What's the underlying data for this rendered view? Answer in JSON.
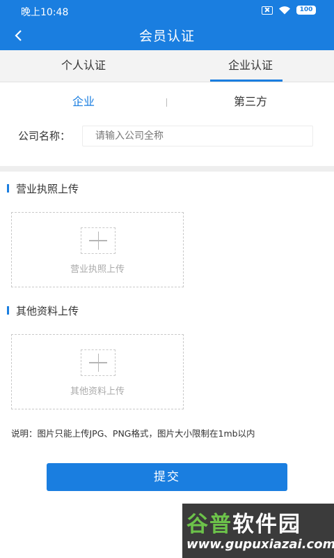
{
  "status_bar": {
    "time": "晚上10:48",
    "battery": "100",
    "icons": [
      "sim-off-icon",
      "wifi-icon",
      "battery-icon"
    ]
  },
  "nav": {
    "back_icon": "‹",
    "title": "会员认证"
  },
  "tabs": {
    "items": [
      {
        "label": "个人认证",
        "active": false
      },
      {
        "label": "企业认证",
        "active": true
      }
    ]
  },
  "subtabs": {
    "items": [
      {
        "label": "企业",
        "active": true
      },
      {
        "label": "第三方",
        "active": false
      }
    ]
  },
  "form": {
    "company_label": "公司名称：",
    "company_placeholder": "请输入公司全称",
    "company_value": ""
  },
  "sections": {
    "license": {
      "title": "营业执照上传",
      "upload_label": "营业执照上传"
    },
    "other": {
      "title": "其他资料上传",
      "upload_label": "其他资料上传"
    }
  },
  "note": "说明：图片只能上传JPG、PNG格式，图片大小限制在1mb以内",
  "submit_label": "提交",
  "watermark": {
    "brand_part1": "谷普",
    "brand_part2": "软件园",
    "url": "www.gupuxiazai.com"
  },
  "colors": {
    "primary": "#1a7ee0",
    "tab_bg": "#f3f3f3",
    "divider": "#eeeeee"
  }
}
